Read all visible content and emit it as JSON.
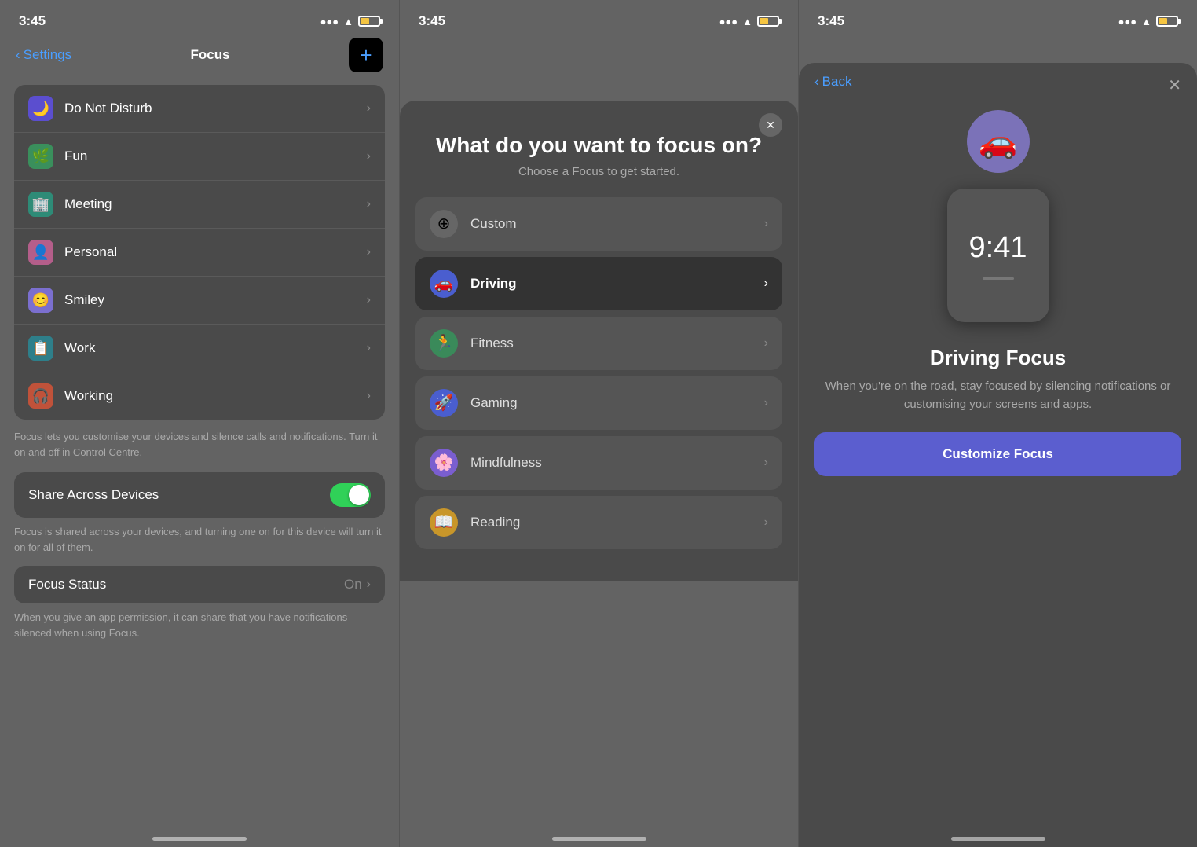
{
  "panel1": {
    "status": {
      "time": "3:45"
    },
    "nav": {
      "back_label": "Settings",
      "title": "Focus",
      "add_label": "+"
    },
    "focus_items": [
      {
        "name": "Do Not Disturb",
        "icon": "🌙",
        "color": "purple"
      },
      {
        "name": "Fun",
        "icon": "🌿",
        "color": "green"
      },
      {
        "name": "Meeting",
        "icon": "🏢",
        "color": "teal"
      },
      {
        "name": "Personal",
        "icon": "👤",
        "color": "pink"
      },
      {
        "name": "Smiley",
        "icon": "😊",
        "color": "lavender"
      },
      {
        "name": "Work",
        "icon": "📋",
        "color": "blue-green"
      },
      {
        "name": "Working",
        "icon": "🎧",
        "color": "orange"
      }
    ],
    "focus_description": "Focus lets you customise your devices and silence calls and notifications. Turn it on and off in Control Centre.",
    "share_across_devices": "Share Across Devices",
    "share_description": "Focus is shared across your devices, and turning one on for this device will turn it on for all of them.",
    "focus_status_label": "Focus Status",
    "focus_status_value": "On",
    "focus_status_description": "When you give an app permission, it can share that you have notifications silenced when using Focus."
  },
  "panel2": {
    "status": {
      "time": "3:45"
    },
    "close_icon": "✕",
    "title": "What do you want to focus on?",
    "subtitle": "Choose a Focus to get started.",
    "options": [
      {
        "name": "Custom",
        "icon": "⊕",
        "icon_class": "gray-circle",
        "selected": false
      },
      {
        "name": "Driving",
        "icon": "🚗",
        "icon_class": "dark-blue",
        "selected": true
      },
      {
        "name": "Fitness",
        "icon": "🏃",
        "icon_class": "green-fit",
        "selected": false
      },
      {
        "name": "Gaming",
        "icon": "🚀",
        "icon_class": "blue-game",
        "selected": false
      },
      {
        "name": "Mindfulness",
        "icon": "🌸",
        "icon_class": "purple-mind",
        "selected": false
      },
      {
        "name": "Reading",
        "icon": "📖",
        "icon_class": "yellow-read",
        "selected": false
      }
    ]
  },
  "panel3": {
    "status": {
      "time": "3:45"
    },
    "back_label": "Back",
    "close_icon": "✕",
    "car_icon": "🚗",
    "phone_time": "9:41",
    "title": "Driving Focus",
    "description": "When you're on the road, stay focused by silencing notifications or customising your screens and apps.",
    "customize_btn": "Customize Focus"
  }
}
